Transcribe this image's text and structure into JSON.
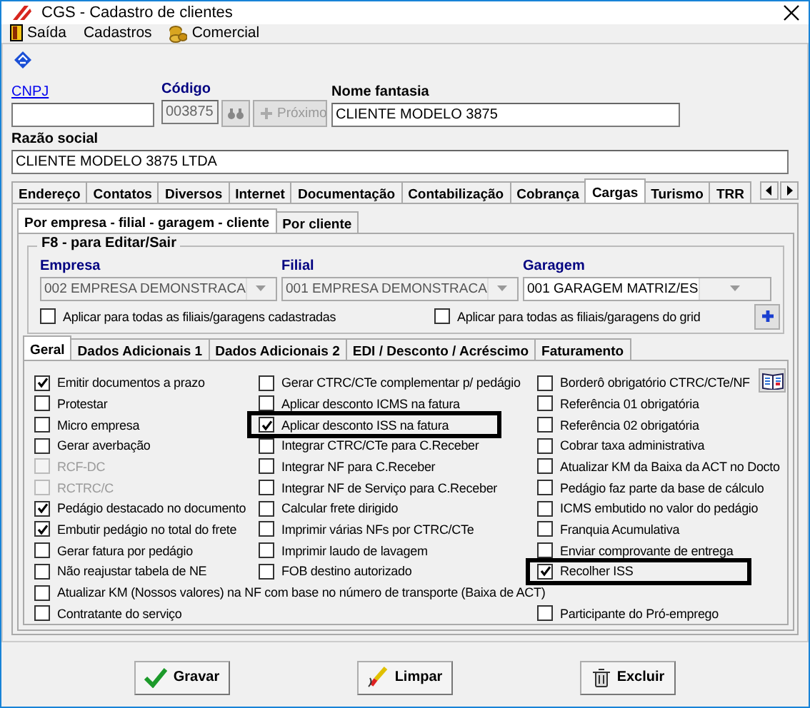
{
  "window": {
    "title": "CGS - Cadastro de clientes"
  },
  "menu": [
    {
      "label": "Saída"
    },
    {
      "label": "Cadastros"
    },
    {
      "label": "Comercial"
    }
  ],
  "form": {
    "cnpj": {
      "label": "CNPJ"
    },
    "codigo": {
      "label": "Código",
      "value": "003875"
    },
    "next_button": {
      "label": "Próximo",
      "disabled": true
    },
    "nome_fantasia": {
      "label": "Nome fantasia",
      "value": "CLIENTE MODELO 3875"
    },
    "razao_social": {
      "label": "Razão social",
      "value": "CLIENTE MODELO 3875 LTDA"
    }
  },
  "tabs": [
    {
      "label": "Endereço",
      "selected": false
    },
    {
      "label": "Contatos",
      "selected": false
    },
    {
      "label": "Diversos",
      "selected": false
    },
    {
      "label": "Internet",
      "selected": false
    },
    {
      "label": "Documentação",
      "selected": false
    },
    {
      "label": "Contabilização",
      "selected": false
    },
    {
      "label": "Cobrança",
      "selected": false
    },
    {
      "label": "Cargas",
      "selected": true
    },
    {
      "label": "Turismo",
      "selected": false
    },
    {
      "label": "TRR",
      "selected": false
    }
  ],
  "sub_tabs": [
    {
      "label": "Por empresa - filial - garagem - cliente",
      "selected": true
    },
    {
      "label": "Por cliente",
      "selected": false
    }
  ],
  "group": {
    "title": "F8 - para Editar/Sair",
    "selects": [
      {
        "label": "Empresa",
        "value": "002 EMPRESA DEMONSTRACA",
        "disabled": true
      },
      {
        "label": "Filial",
        "value": "001 EMPRESA DEMONSTRACA",
        "disabled": true
      },
      {
        "label": "Garagem",
        "value": "001 GARAGEM MATRIZ/ES",
        "disabled": false
      }
    ],
    "checkboxes": [
      {
        "label": "Aplicar para todas as filiais/garagens cadastradas",
        "checked": false
      },
      {
        "label": "Aplicar para todas as filiais/garagens do grid",
        "checked": false
      }
    ]
  },
  "option_tabs": [
    {
      "label": "Geral",
      "selected": true
    },
    {
      "label": "Dados Adicionais 1",
      "selected": false
    },
    {
      "label": "Dados Adicionais 2",
      "selected": false
    },
    {
      "label": "EDI / Desconto / Acréscimo",
      "selected": false
    },
    {
      "label": "Faturamento",
      "selected": false
    }
  ],
  "options": [
    [
      {
        "kind": "check",
        "label": "Emitir documentos a prazo",
        "checked": true,
        "disabled": false,
        "highlighted": false
      },
      {
        "kind": "check",
        "label": "Protestar",
        "checked": false,
        "disabled": false,
        "highlighted": false
      },
      {
        "kind": "check",
        "label": "Micro empresa",
        "checked": false,
        "disabled": false,
        "highlighted": false
      },
      {
        "kind": "check",
        "label": "Gerar averbação",
        "checked": false,
        "disabled": false,
        "highlighted": false
      },
      {
        "kind": "check",
        "label": "RCF-DC",
        "checked": false,
        "disabled": true,
        "highlighted": false
      },
      {
        "kind": "check",
        "label": "RCTRC/C",
        "checked": false,
        "disabled": true,
        "highlighted": false
      },
      {
        "kind": "check",
        "label": "Pedágio destacado no documento",
        "checked": true,
        "disabled": false,
        "highlighted": false
      },
      {
        "kind": "check",
        "label": "Embutir pedágio no total do frete",
        "checked": true,
        "disabled": false,
        "highlighted": false
      },
      {
        "kind": "check",
        "label": "Gerar fatura por pedágio",
        "checked": false,
        "disabled": false,
        "highlighted": false
      },
      {
        "kind": "check",
        "label": "Não reajustar tabela de NE",
        "checked": false,
        "disabled": false,
        "highlighted": false
      },
      {
        "kind": "wide",
        "label": "Atualizar KM (Nossos valores) na NF com base no número de transporte (Baixa de ACT)",
        "checked": false,
        "disabled": false,
        "highlighted": false
      },
      {
        "kind": "check",
        "label": "Contratante do serviço",
        "checked": false,
        "disabled": false,
        "highlighted": false
      }
    ],
    [
      {
        "kind": "check",
        "label": "Gerar CTRC/CTe complementar p/ pedágio",
        "checked": false,
        "disabled": false,
        "highlighted": false
      },
      {
        "kind": "check",
        "label": "Aplicar desconto ICMS na fatura",
        "checked": false,
        "disabled": false,
        "highlighted": false
      },
      {
        "kind": "check",
        "label": "Aplicar desconto ISS na fatura",
        "checked": true,
        "disabled": false,
        "highlighted": true
      },
      {
        "kind": "check",
        "label": "Integrar CTRC/CTe para C.Receber",
        "checked": false,
        "disabled": false,
        "highlighted": false
      },
      {
        "kind": "check",
        "label": "Integrar NF para C.Receber",
        "checked": false,
        "disabled": false,
        "highlighted": false
      },
      {
        "kind": "check",
        "label": "Integrar NF de Serviço para C.Receber",
        "checked": false,
        "disabled": false,
        "highlighted": false
      },
      {
        "kind": "check",
        "label": "Calcular frete dirigido",
        "checked": false,
        "disabled": false,
        "highlighted": false
      },
      {
        "kind": "check",
        "label": "Imprimir várias NFs por CTRC/CTe",
        "checked": false,
        "disabled": false,
        "highlighted": false
      },
      {
        "kind": "check",
        "label": "Imprimir laudo de lavagem",
        "checked": false,
        "disabled": false,
        "highlighted": false
      },
      {
        "kind": "check",
        "label": "FOB destino autorizado",
        "checked": false,
        "disabled": false,
        "highlighted": false
      }
    ],
    [
      {
        "kind": "check",
        "label": "Borderô obrigatório  CTRC/CTe/NF",
        "checked": false,
        "disabled": false,
        "highlighted": false
      },
      {
        "kind": "check",
        "label": "Referência 01 obrigatória",
        "checked": false,
        "disabled": false,
        "highlighted": false
      },
      {
        "kind": "check",
        "label": "Referência 02 obrigatória",
        "checked": false,
        "disabled": false,
        "highlighted": false
      },
      {
        "kind": "check",
        "label": "Cobrar taxa administrativa",
        "checked": false,
        "disabled": false,
        "highlighted": false
      },
      {
        "kind": "check",
        "label": "Atualizar KM da Baixa da ACT no Docto",
        "checked": false,
        "disabled": false,
        "highlighted": false
      },
      {
        "kind": "check",
        "label": "Pedágio faz parte da base de cálculo",
        "checked": false,
        "disabled": false,
        "highlighted": false
      },
      {
        "kind": "check",
        "label": "ICMS embutido no valor do pedágio",
        "checked": false,
        "disabled": false,
        "highlighted": false
      },
      {
        "kind": "check",
        "label": "Franquia Acumulativa",
        "checked": false,
        "disabled": false,
        "highlighted": false
      },
      {
        "kind": "check",
        "label": "Enviar comprovante de entrega",
        "checked": false,
        "disabled": false,
        "highlighted": false
      },
      {
        "kind": "check",
        "label": "Recolher ISS",
        "checked": true,
        "disabled": false,
        "highlighted": true
      },
      {
        "kind": "check",
        "label": "Participante do Pró-emprego",
        "checked": false,
        "disabled": false,
        "highlighted": false
      }
    ]
  ],
  "buttons": [
    {
      "label": "Gravar"
    },
    {
      "label": "Limpar"
    },
    {
      "label": "Excluir"
    }
  ]
}
